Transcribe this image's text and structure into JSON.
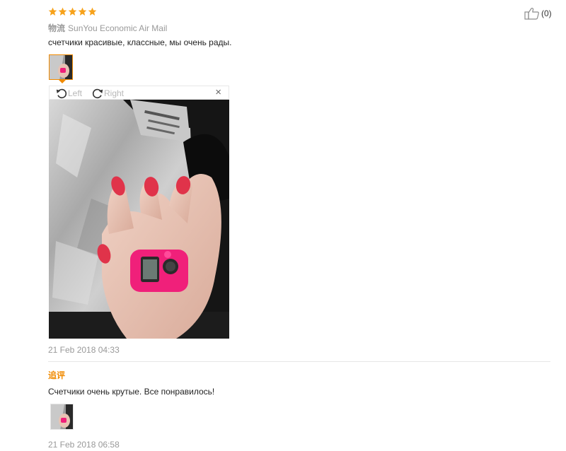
{
  "review": {
    "rating": 5,
    "helpful_count": "(0)",
    "shipping_label": "物流",
    "shipping_method": "SunYou Economic Air Mail",
    "text": "счетчики красивые, классные, мы очень рады.",
    "date": "21 Feb 2018 04:33"
  },
  "viewer": {
    "rotate_left_label": "Left",
    "rotate_right_label": "Right",
    "close_label": "×"
  },
  "followup": {
    "label": "追评",
    "text": "Счетчики очень крутые. Все понравилось!",
    "date": "21 Feb 2018 06:58"
  },
  "colors": {
    "star": "#f7a21b",
    "accent": "#f08a00",
    "ring_pink": "#f0207a",
    "nail_red": "#e0334a"
  },
  "icons": [
    "star-icon",
    "thumbs-up-icon",
    "rotate-left-icon",
    "rotate-right-icon",
    "close-icon"
  ]
}
